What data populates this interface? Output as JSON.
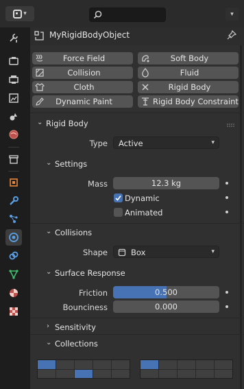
{
  "object": {
    "name": "MyRigidBodyObject"
  },
  "physics_buttons": [
    {
      "label": "Force Field",
      "icon": "force-field-icon"
    },
    {
      "label": "Soft Body",
      "icon": "soft-body-icon"
    },
    {
      "label": "Collision",
      "icon": "collision-icon"
    },
    {
      "label": "Fluid",
      "icon": "fluid-icon"
    },
    {
      "label": "Cloth",
      "icon": "cloth-icon"
    },
    {
      "label": "Rigid Body",
      "icon": "close-x-icon"
    },
    {
      "label": "Dynamic Paint",
      "icon": "dynamic-paint-icon"
    },
    {
      "label": "Rigid Body Constraint",
      "icon": "constraint-icon"
    }
  ],
  "rigid_body": {
    "title": "Rigid Body",
    "type_label": "Type",
    "type_value": "Active"
  },
  "settings": {
    "title": "Settings",
    "mass_label": "Mass",
    "mass_value": "12.3 kg",
    "dynamic_label": "Dynamic",
    "dynamic_checked": true,
    "animated_label": "Animated",
    "animated_checked": false
  },
  "collisions": {
    "title": "Collisions",
    "shape_label": "Shape",
    "shape_value": "Box"
  },
  "surface_response": {
    "title": "Surface Response",
    "friction_label": "Friction",
    "friction_value": "0.500",
    "friction_fraction": 0.5,
    "bounciness_label": "Bounciness",
    "bounciness_value": "0.000"
  },
  "sensitivity": {
    "title": "Sensitivity"
  },
  "collections_panel": {
    "title": "Collections"
  },
  "colors": {
    "accent": "#4772b3",
    "panel_bg": "#303030",
    "button_bg": "#545454"
  }
}
